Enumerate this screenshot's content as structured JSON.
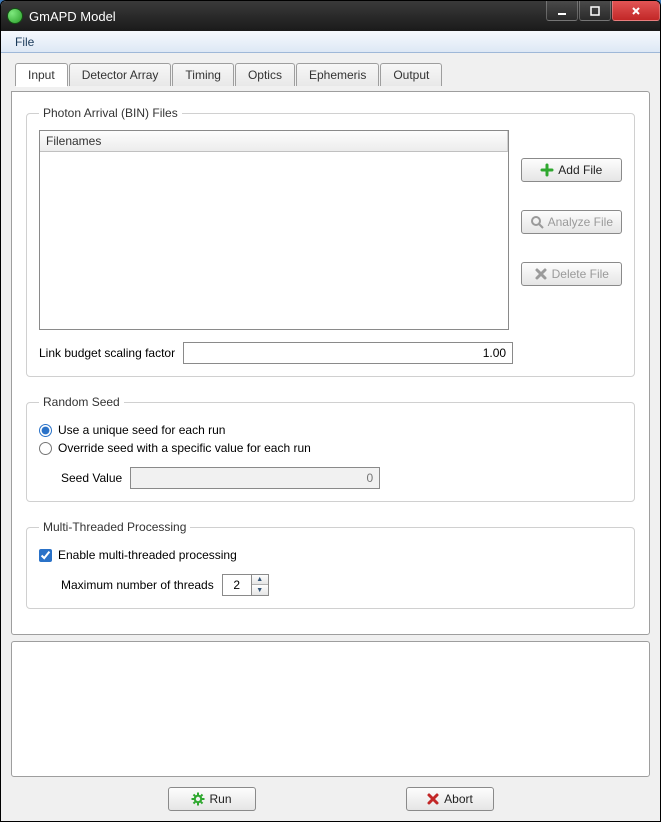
{
  "window": {
    "title": "GmAPD Model"
  },
  "menubar": {
    "file": "File"
  },
  "tabs": {
    "input": "Input",
    "detector_array": "Detector Array",
    "timing": "Timing",
    "optics": "Optics",
    "ephemeris": "Ephemeris",
    "output": "Output"
  },
  "groups": {
    "bin_files": "Photon Arrival (BIN) Files",
    "random_seed": "Random Seed",
    "multithread": "Multi-Threaded Processing"
  },
  "file_list": {
    "header": "Filenames"
  },
  "buttons": {
    "add_file": "Add File",
    "analyze_file": "Analyze File",
    "delete_file": "Delete File",
    "run": "Run",
    "abort": "Abort"
  },
  "labels": {
    "link_budget": "Link budget scaling factor",
    "radio_unique": "Use a unique seed for each run",
    "radio_override": "Override seed with a specific value for each run",
    "seed_value": "Seed Value",
    "enable_mt": "Enable multi-threaded processing",
    "max_threads": "Maximum number of threads"
  },
  "values": {
    "link_budget": "1.00",
    "seed_value": "0",
    "max_threads": "2"
  },
  "state": {
    "radio_seed_selected": "unique",
    "enable_mt_checked": true
  },
  "icons": {
    "add": "plus-icon",
    "analyze": "magnifier-icon",
    "delete": "x-icon",
    "run": "gear-icon",
    "abort": "x-icon"
  },
  "colors": {
    "add": "#2fa82f",
    "delete": "#8a8a8a",
    "analyze": "#8a8a8a",
    "run": "#2fa82f",
    "abort": "#c22727"
  }
}
